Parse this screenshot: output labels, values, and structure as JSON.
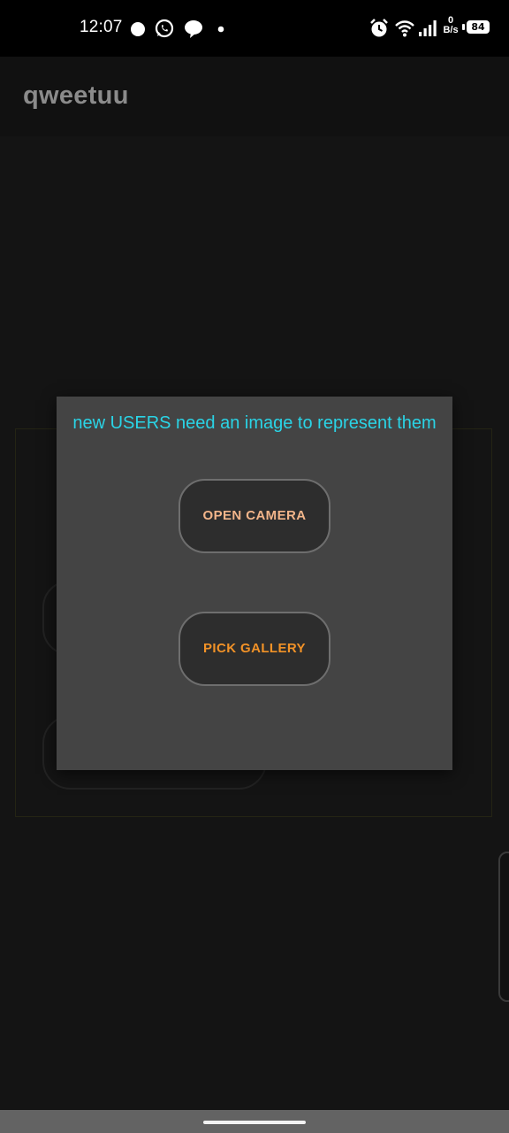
{
  "status_bar": {
    "time": "12:07",
    "net_speed_value": "0",
    "net_speed_unit": "B/s",
    "battery_level": "84",
    "icons": [
      "circle-notification-icon",
      "whatsapp-icon",
      "chat-bubble-icon",
      "more-dot-icon",
      "alarm-icon",
      "wifi-icon",
      "signal-icon",
      "battery-icon"
    ]
  },
  "app_bar": {
    "title": "qweetuu"
  },
  "dialog": {
    "title": "new USERS need an image to represent them",
    "open_camera_label": "OPEN CAMERA",
    "pick_gallery_label": "PICK GALLERY"
  },
  "colors": {
    "dialog_title": "#2ad4e6",
    "open_camera_text": "#f2b58a",
    "pick_gallery_text": "#f29227",
    "dialog_background": "#444444",
    "page_background": "#141414"
  }
}
